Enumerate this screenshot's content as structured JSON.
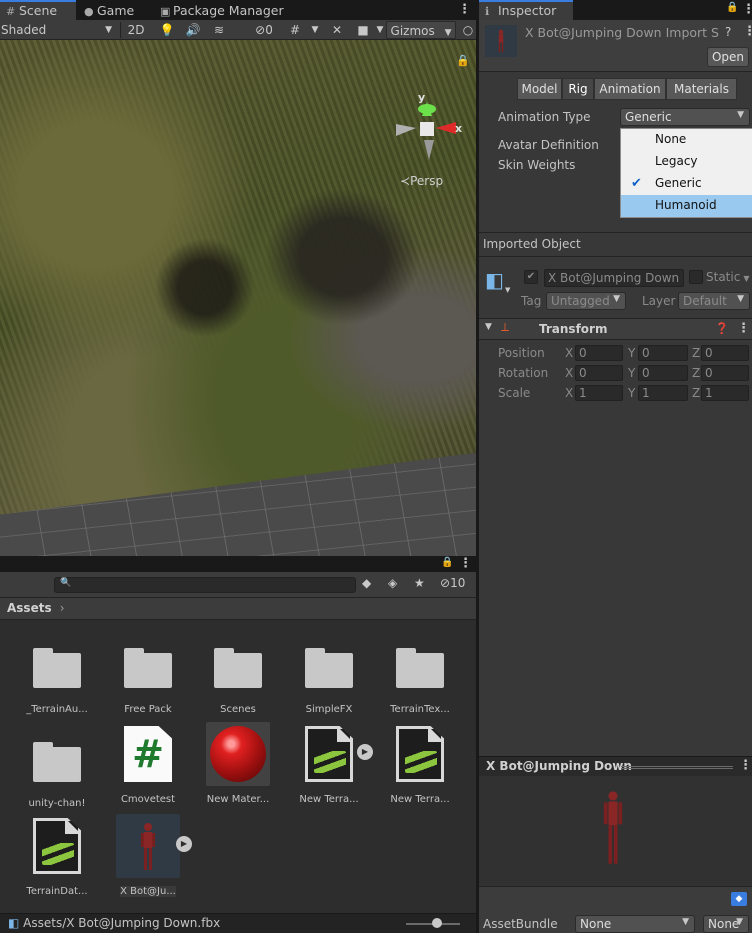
{
  "scene_tabs": {
    "scene": "Scene",
    "game": "Game",
    "package_manager": "Package Manager"
  },
  "scene_toolbar": {
    "shading_mode": "Shaded",
    "two_d": "2D",
    "hidden_count": "0",
    "gizmos": "Gizmos"
  },
  "viewport": {
    "gizmo_y": "y",
    "gizmo_x": "x",
    "projection": "Persp"
  },
  "project": {
    "search_placeholder": "",
    "hidden_count": "10",
    "breadcrumb": "Assets",
    "assets": [
      {
        "label": "_TerrainAu...",
        "kind": "folder"
      },
      {
        "label": "Free Pack",
        "kind": "folder"
      },
      {
        "label": "Scenes",
        "kind": "folder"
      },
      {
        "label": "SimpleFX",
        "kind": "folder"
      },
      {
        "label": "TerrainTex...",
        "kind": "folder"
      },
      {
        "label": "unity-chan!",
        "kind": "folder"
      },
      {
        "label": "Cmovetest",
        "kind": "script",
        "glyph": "#"
      },
      {
        "label": "New Mater...",
        "kind": "material"
      },
      {
        "label": "New Terra...",
        "kind": "terrain-layer"
      },
      {
        "label": "New Terra...",
        "kind": "terrain-data"
      },
      {
        "label": "TerrainDat...",
        "kind": "terrain-data"
      },
      {
        "label": "X Bot@Ju...",
        "kind": "model",
        "selected": true
      }
    ],
    "status_path": "Assets/X Bot@Jumping Down.fbx"
  },
  "inspector": {
    "tab": "Inspector",
    "title": "X Bot@Jumping Down Import S",
    "open_button": "Open",
    "tabs": [
      "Model",
      "Rig",
      "Animation",
      "Materials"
    ],
    "active_tab": "Rig",
    "animation_type_label": "Animation Type",
    "animation_type_value": "Generic",
    "avatar_definition_label": "Avatar Definition",
    "skin_weights_label": "Skin Weights",
    "animation_type_options": [
      "None",
      "Legacy",
      "Generic",
      "Humanoid"
    ],
    "checked_option": "Generic",
    "hover_option": "Humanoid",
    "imported_object_header": "Imported Object",
    "object_name": "X Bot@Jumping Down",
    "static_label": "Static",
    "tag_label": "Tag",
    "tag_value": "Untagged",
    "layer_label": "Layer",
    "layer_value": "Default",
    "transform": {
      "header": "Transform",
      "rows": [
        {
          "label": "Position",
          "x": "0",
          "y": "0",
          "z": "0"
        },
        {
          "label": "Rotation",
          "x": "0",
          "y": "0",
          "z": "0"
        },
        {
          "label": "Scale",
          "x": "1",
          "y": "1",
          "z": "1"
        }
      ],
      "axes": [
        "X",
        "Y",
        "Z"
      ]
    },
    "preview_title": "X Bot@Jumping Down",
    "asset_bundle_label": "AssetBundle",
    "asset_bundle_value": "None",
    "asset_bundle_variant": "None"
  },
  "colors": {
    "accent_blue": "#3a7de0",
    "popup_hover": "#99c9ef",
    "terrain_green": "#8cc63e"
  }
}
